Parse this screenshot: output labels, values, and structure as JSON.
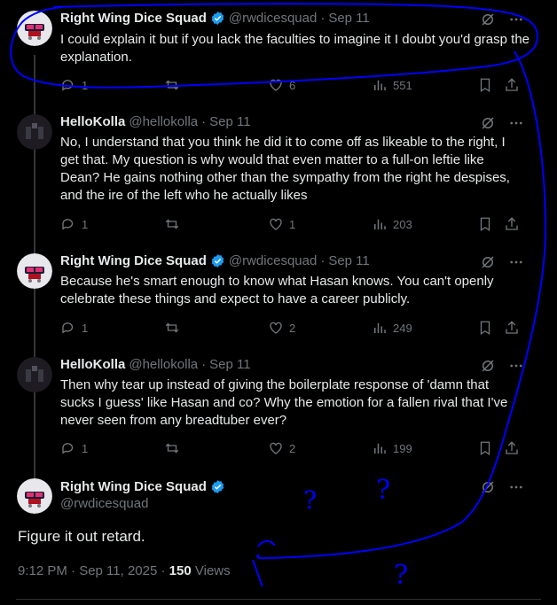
{
  "colors": {
    "background": "#000000",
    "text": "#e7e9ea",
    "muted": "#71767b",
    "verified": "#1d9bf0",
    "annotation": "#0000ff"
  },
  "tweets": [
    {
      "name": "Right Wing Dice Squad",
      "handle": "@rwdicesquad",
      "date": "Sep 11",
      "verified": true,
      "text": "I could explain it but if you lack the faculties to imagine it I doubt you'd grasp the explanation.",
      "replies": "1",
      "likes": "6",
      "views": "551"
    },
    {
      "name": "HelloKolla",
      "handle": "@hellokolla",
      "date": "Sep 11",
      "verified": false,
      "text": "No, I understand that you think he did it to come off as likeable to the right, I get that. My question is why would that even matter to a full-on leftie like Dean? He gains nothing other than the sympathy from the right he despises, and the ire of the left who he actually likes",
      "replies": "1",
      "likes": "1",
      "views": "203"
    },
    {
      "name": "Right Wing Dice Squad",
      "handle": "@rwdicesquad",
      "date": "Sep 11",
      "verified": true,
      "text": "Because he's smart enough to know what Hasan knows.  You can't openly celebrate these things and expect to have a career publicly.",
      "replies": "1",
      "likes": "2",
      "views": "249"
    },
    {
      "name": "HelloKolla",
      "handle": "@hellokolla",
      "date": "Sep 11",
      "verified": false,
      "text": "Then why tear up instead of giving the boilerplate response of 'damn that sucks I guess' like Hasan and co? Why the emotion for a fallen rival that I've never seen from any breadtuber ever?",
      "replies": "1",
      "likes": "2",
      "views": "199"
    }
  ],
  "focal": {
    "name": "Right Wing Dice Squad",
    "handle": "@rwdicesquad",
    "text": "Figure it out retard.",
    "time": "9:12 PM · Sep 11, 2025",
    "views_count": "150",
    "views_label": "Views"
  },
  "annotations": {
    "marks": [
      "?",
      "?",
      "?"
    ]
  }
}
